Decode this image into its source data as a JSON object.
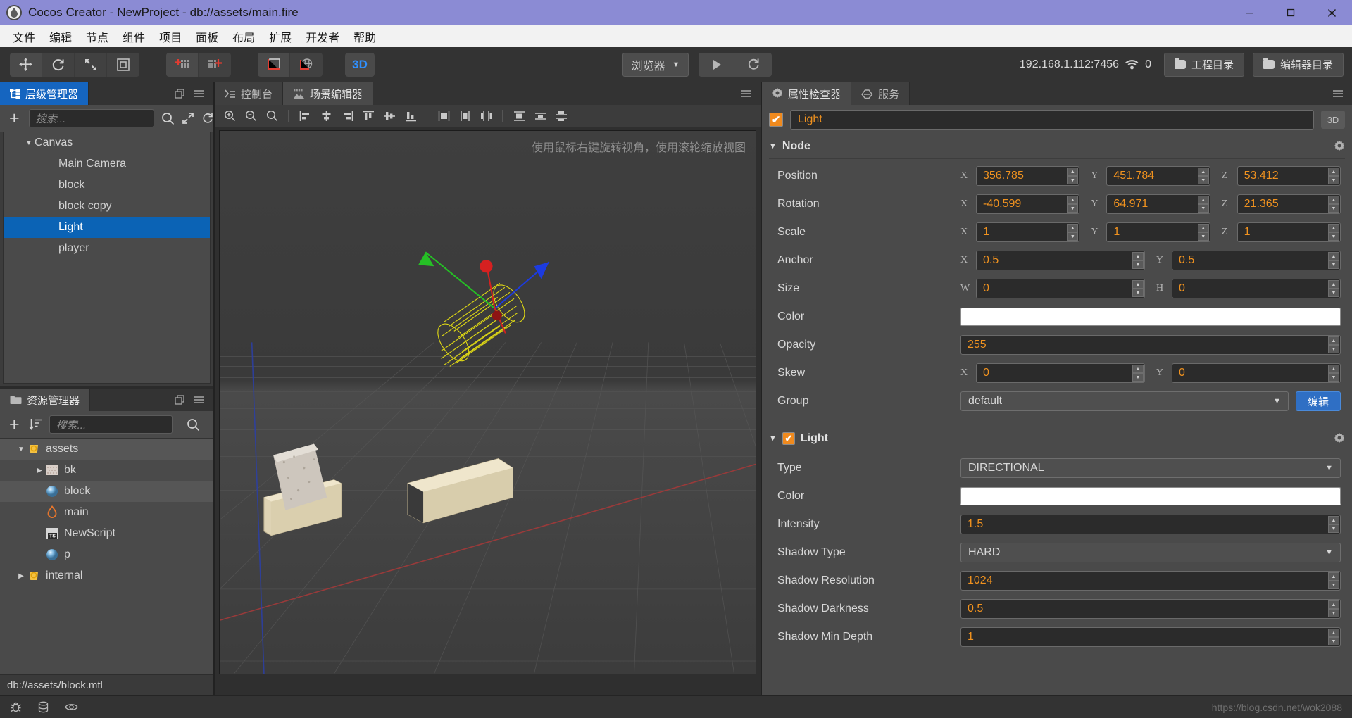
{
  "window": {
    "title": "Cocos Creator - NewProject - db://assets/main.fire",
    "logo_icon": "cocos-logo-icon",
    "minimize_icon": "minimize-icon",
    "maximize_icon": "maximize-icon",
    "close_icon": "close-icon"
  },
  "menubar": {
    "items": [
      {
        "label": "文件"
      },
      {
        "label": "编辑"
      },
      {
        "label": "节点"
      },
      {
        "label": "组件"
      },
      {
        "label": "项目"
      },
      {
        "label": "面板"
      },
      {
        "label": "布局"
      },
      {
        "label": "扩展"
      },
      {
        "label": "开发者"
      },
      {
        "label": "帮助"
      }
    ]
  },
  "toolbar": {
    "transform_tools": [
      {
        "name": "move-tool-icon"
      },
      {
        "name": "rotate-tool-icon"
      },
      {
        "name": "scale-tool-icon"
      },
      {
        "name": "rect-tool-icon"
      }
    ],
    "pivot_tools": [
      {
        "name": "pivot-center-icon"
      },
      {
        "name": "pivot-pivot-icon"
      }
    ],
    "coord_tools": [
      {
        "name": "coord-local-icon"
      },
      {
        "name": "coord-global-icon"
      }
    ],
    "mode_3d_label": "3D",
    "browser_label": "浏览器",
    "browser_caret": "▼",
    "play_icon": "play-icon",
    "reload_icon": "reload-icon",
    "ip_address": "192.168.1.112:7456",
    "wifi_icon": "wifi-icon",
    "device_count": "0",
    "project_dir_label": "工程目录",
    "editor_dir_label": "编辑器目录"
  },
  "hierarchy": {
    "tab_label": "层级管理器",
    "tab_icon": "hierarchy-icon",
    "dock_icon": "dock-icon",
    "menu_icon": "hamburger-icon",
    "add_icon": "plus-icon",
    "search_placeholder": "搜索...",
    "search_icon": "search-icon",
    "expand_icon": "expand-icon",
    "refresh_icon": "refresh-icon",
    "nodes": [
      {
        "label": "Canvas",
        "depth": 0,
        "expanded": true,
        "selected": false
      },
      {
        "label": "Main Camera",
        "depth": 1,
        "expanded": null,
        "selected": false
      },
      {
        "label": "block",
        "depth": 1,
        "expanded": null,
        "selected": false
      },
      {
        "label": "block copy",
        "depth": 1,
        "expanded": null,
        "selected": false
      },
      {
        "label": "Light",
        "depth": 1,
        "expanded": null,
        "selected": true
      },
      {
        "label": "player",
        "depth": 1,
        "expanded": null,
        "selected": false
      }
    ]
  },
  "assets": {
    "tab_label": "资源管理器",
    "tab_icon": "folder-icon",
    "dock_icon": "dock-icon",
    "menu_icon": "hamburger-icon",
    "add_icon": "plus-icon",
    "sort_icon": "sort-icon",
    "search_placeholder": "搜索...",
    "search_icon": "search-icon",
    "items": [
      {
        "label": "assets",
        "depth": 0,
        "icon": "assets-folder-icon",
        "expanded": true,
        "selected": false
      },
      {
        "label": "bk",
        "depth": 1,
        "icon": "texture-icon",
        "expanded": false,
        "selected": false
      },
      {
        "label": "block",
        "depth": 1,
        "icon": "material-icon",
        "expanded": null,
        "selected": true
      },
      {
        "label": "main",
        "depth": 1,
        "icon": "scene-fire-icon",
        "expanded": null,
        "selected": false
      },
      {
        "label": "NewScript",
        "depth": 1,
        "icon": "typescript-icon",
        "expanded": null,
        "selected": false
      },
      {
        "label": "p",
        "depth": 1,
        "icon": "material-icon",
        "expanded": null,
        "selected": false
      },
      {
        "label": "internal",
        "depth": 0,
        "icon": "assets-folder-icon",
        "expanded": false,
        "selected": false
      }
    ],
    "status_path": "db://assets/block.mtl"
  },
  "center": {
    "tabs": [
      {
        "label": "控制台",
        "icon": "console-icon",
        "active": false
      },
      {
        "label": "场景编辑器",
        "icon": "scene-icon",
        "active": true
      }
    ],
    "menu_icon": "hamburger-icon",
    "scene_tools": [
      {
        "name": "zoom-in-icon"
      },
      {
        "name": "zoom-out-icon"
      },
      {
        "name": "zoom-fit-icon"
      },
      {
        "name": "align-left-icon"
      },
      {
        "name": "align-hcenter-icon"
      },
      {
        "name": "align-right-icon"
      },
      {
        "name": "align-top-icon"
      },
      {
        "name": "align-vcenter-icon"
      },
      {
        "name": "align-bottom-icon"
      },
      {
        "name": "distribute-left-icon"
      },
      {
        "name": "distribute-hcenter-icon"
      },
      {
        "name": "distribute-right-icon"
      },
      {
        "name": "distribute-top-icon"
      },
      {
        "name": "distribute-vcenter-icon"
      },
      {
        "name": "distribute-bottom-icon"
      }
    ],
    "hint": "使用鼠标右键旋转视角，使用滚轮缩放视图"
  },
  "inspector": {
    "tabs": [
      {
        "label": "属性检查器",
        "icon": "gear-icon",
        "active": true
      },
      {
        "label": "服务",
        "icon": "service-icon",
        "active": false
      }
    ],
    "menu_icon": "hamburger-icon",
    "node_enabled": true,
    "node_name": "Light",
    "badge_3d": "3D",
    "node_section": {
      "title": "Node",
      "collapse_icon": "▼",
      "gear_icon": "gear-icon",
      "rows": [
        {
          "label": "Position",
          "type": "vec3",
          "fields": [
            {
              "axis": "X",
              "value": "356.785"
            },
            {
              "axis": "Y",
              "value": "451.784"
            },
            {
              "axis": "Z",
              "value": "53.412"
            }
          ]
        },
        {
          "label": "Rotation",
          "type": "vec3",
          "fields": [
            {
              "axis": "X",
              "value": "-40.599"
            },
            {
              "axis": "Y",
              "value": "64.971"
            },
            {
              "axis": "Z",
              "value": "21.365"
            }
          ]
        },
        {
          "label": "Scale",
          "type": "vec3",
          "fields": [
            {
              "axis": "X",
              "value": "1"
            },
            {
              "axis": "Y",
              "value": "1"
            },
            {
              "axis": "Z",
              "value": "1"
            }
          ]
        },
        {
          "label": "Anchor",
          "type": "vec2",
          "fields": [
            {
              "axis": "X",
              "value": "0.5"
            },
            {
              "axis": "Y",
              "value": "0.5"
            }
          ]
        },
        {
          "label": "Size",
          "type": "vec2",
          "fields": [
            {
              "axis": "W",
              "value": "0"
            },
            {
              "axis": "H",
              "value": "0"
            }
          ]
        },
        {
          "label": "Color",
          "type": "color",
          "color": "#ffffff"
        },
        {
          "label": "Opacity",
          "type": "single",
          "value": "255"
        },
        {
          "label": "Skew",
          "type": "vec2",
          "fields": [
            {
              "axis": "X",
              "value": "0"
            },
            {
              "axis": "Y",
              "value": "0"
            }
          ]
        },
        {
          "label": "Group",
          "type": "select",
          "value": "default",
          "button": "编辑"
        }
      ]
    },
    "light_section": {
      "title": "Light",
      "enabled": true,
      "collapse_icon": "▼",
      "gear_icon": "gear-icon",
      "rows": [
        {
          "label": "Type",
          "type": "select",
          "value": "DIRECTIONAL"
        },
        {
          "label": "Color",
          "type": "color",
          "color": "#ffffff"
        },
        {
          "label": "Intensity",
          "type": "single",
          "value": "1.5"
        },
        {
          "label": "Shadow Type",
          "type": "select",
          "value": "HARD"
        },
        {
          "label": "Shadow Resolution",
          "type": "single",
          "value": "1024"
        },
        {
          "label": "Shadow Darkness",
          "type": "single",
          "value": "0.5"
        },
        {
          "label": "Shadow Min Depth",
          "type": "single",
          "value": "1"
        }
      ]
    }
  },
  "statusbar": {
    "icons": [
      {
        "name": "bug-icon"
      },
      {
        "name": "database-icon"
      },
      {
        "name": "eye-icon"
      }
    ],
    "watermark": "https://blog.csdn.net/wok2088"
  },
  "colors": {
    "accent_orange": "#f0921f",
    "selection_blue": "#0b63b5",
    "title_purple": "#8b8bd4",
    "tab_blue": "#1565c0",
    "edit_button_blue": "#2f6fc4"
  }
}
